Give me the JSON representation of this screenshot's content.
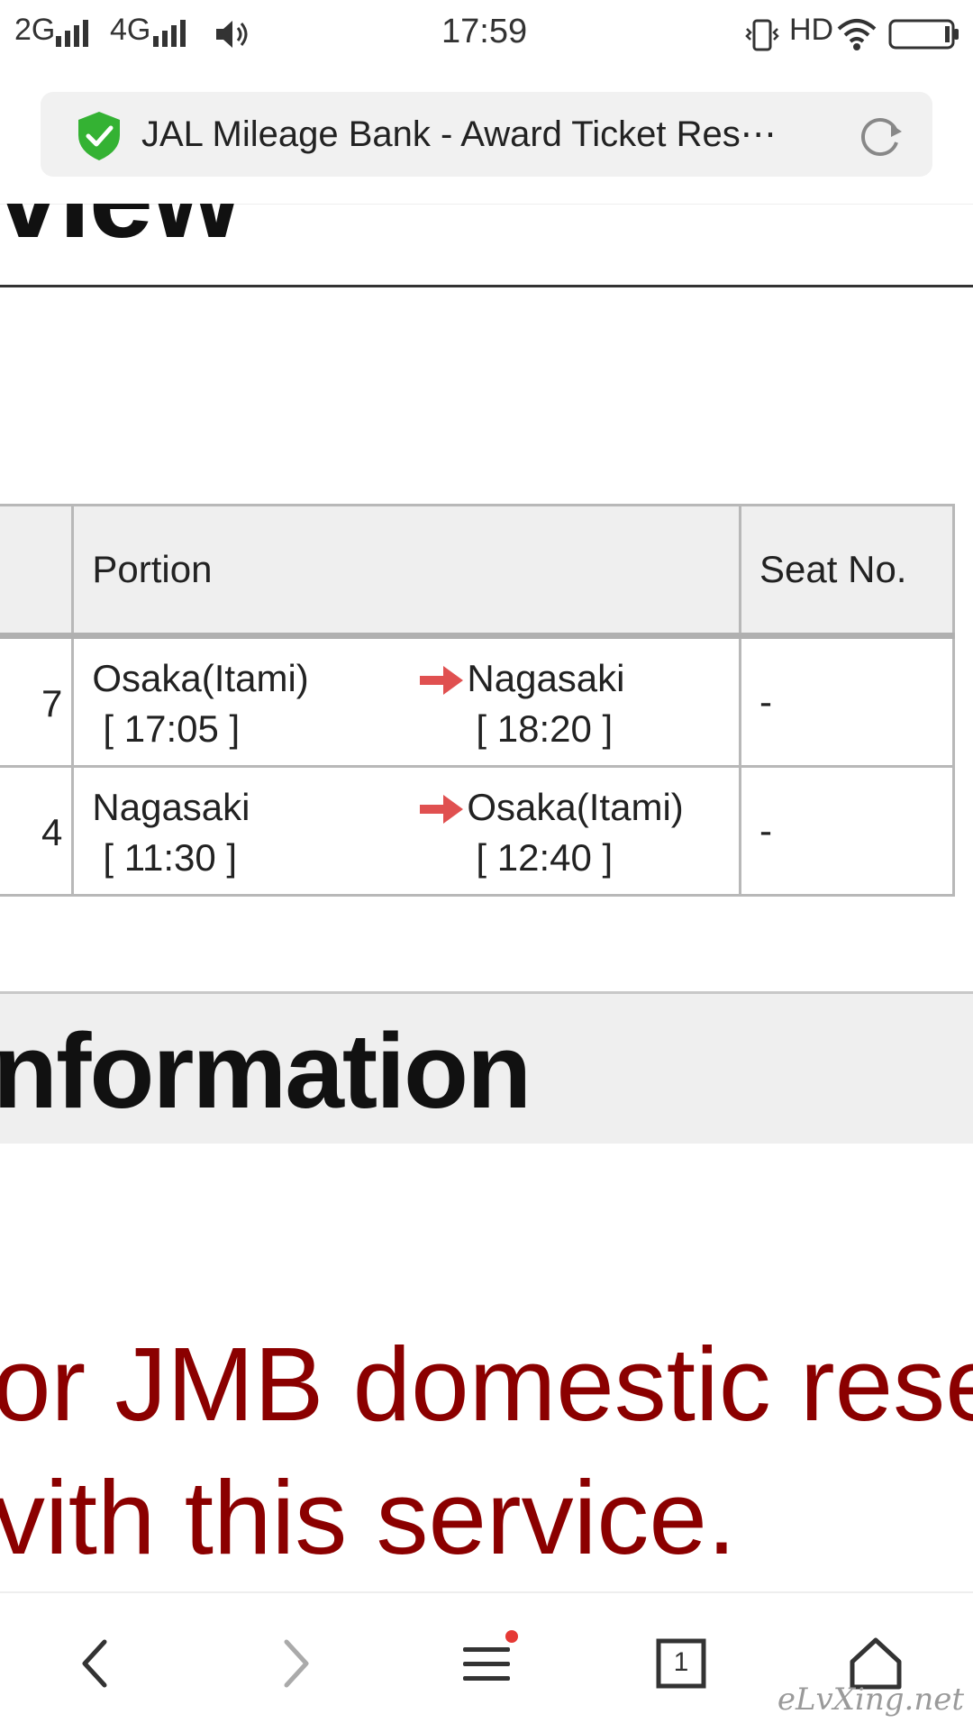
{
  "status_bar": {
    "signal1": "2G",
    "signal2": "4G",
    "time": "17:59",
    "hd": "HD"
  },
  "browser": {
    "page_title": "JAL Mileage Bank - Award Ticket Res⋯"
  },
  "content": {
    "section_heading_partial": "view",
    "table": {
      "headers": {
        "portion": "Portion",
        "seat": "Seat No."
      },
      "rows": [
        {
          "num": "7",
          "from": "Osaka(Itami)",
          "from_time": "[ 17:05 ]",
          "to": "Nagasaki",
          "to_time": "[ 18:20 ]",
          "seat": "-"
        },
        {
          "num": "4",
          "from": "Nagasaki",
          "from_time": "[ 11:30 ]",
          "to": "Osaka(Itami)",
          "to_time": "[ 12:40 ]",
          "seat": "-"
        }
      ]
    },
    "info_heading_partial": "nformation",
    "notice_line1": "or JMB domestic rese",
    "notice_line2": "vith this service."
  },
  "bottom_nav": {
    "tab_count": "1"
  },
  "watermark": "eLvXing.net",
  "colors": {
    "accent_red": "#8b0000",
    "arrow_red": "#e05050",
    "shield_green": "#34b233"
  }
}
